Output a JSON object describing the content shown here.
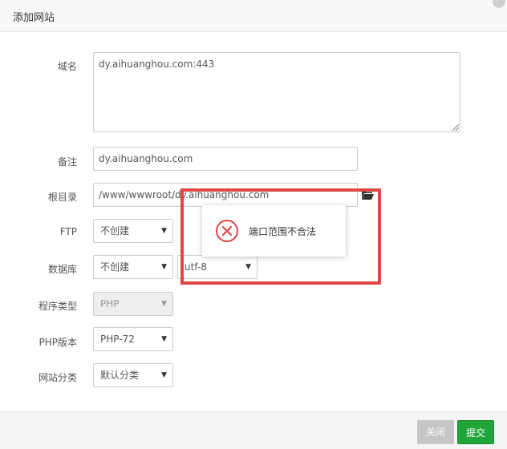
{
  "dialog": {
    "title": "添加网站"
  },
  "form": {
    "domain_label": "域名",
    "domain_value": "dy.aihuanghou.com:443",
    "remark_label": "备注",
    "remark_value": "dy.aihuanghou.com",
    "root_label": "根目录",
    "root_value": "/www/wwwroot/dy.aihuanghou.com",
    "ftp_label": "FTP",
    "ftp_value": "不创建",
    "db_label": "数据库",
    "db_value": "不创建",
    "db_charset": "utf-8",
    "program_label": "程序类型",
    "program_value": "PHP",
    "php_label": "PHP版本",
    "php_value": "PHP-72",
    "category_label": "网站分类",
    "category_value": "默认分类"
  },
  "footer": {
    "close_label": "关闭",
    "submit_label": "提交"
  },
  "toast": {
    "message": "端口范围不合法"
  },
  "colors": {
    "accent_green": "#20a53a",
    "error_red": "#e04646"
  },
  "icons": {
    "folder": "folder-open-icon",
    "error": "error-circle-x-icon",
    "caret": "caret-down-icon"
  }
}
